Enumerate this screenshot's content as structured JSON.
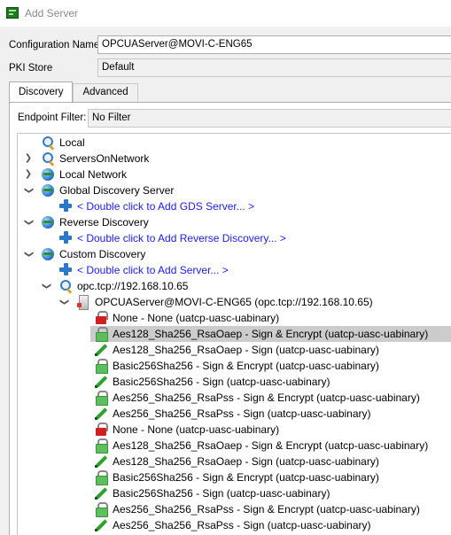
{
  "window": {
    "title": "Add Server"
  },
  "form": {
    "config_name_label": "Configuration Name",
    "config_name_value": "OPCUAServer@MOVI-C-ENG65",
    "pki_store_label": "PKI Store",
    "pki_store_value": "Default"
  },
  "tabs": [
    {
      "label": "Discovery",
      "active": true
    },
    {
      "label": "Advanced",
      "active": false
    }
  ],
  "filter": {
    "label": "Endpoint Filter:",
    "value": "No Filter"
  },
  "tree": {
    "local": "Local",
    "servers_on_network": "ServersOnNetwork",
    "local_network": "Local Network",
    "gds": "Global Discovery Server",
    "gds_add": "< Double click to Add GDS Server... >",
    "reverse": "Reverse Discovery",
    "reverse_add": "< Double click to Add Reverse Discovery... >",
    "custom": "Custom Discovery",
    "custom_add": "< Double click to Add Server... >",
    "host": "opc.tcp://192.168.10.65",
    "server": "OPCUAServer@MOVI-C-ENG65 (opc.tcp://192.168.10.65)",
    "endpoints": [
      {
        "label": "None - None (uatcp-uasc-uabinary)",
        "icon": "lock-red"
      },
      {
        "label": "Aes128_Sha256_RsaOaep - Sign & Encrypt (uatcp-uasc-uabinary)",
        "icon": "lock-green",
        "selected": true
      },
      {
        "label": "Aes128_Sha256_RsaOaep - Sign (uatcp-uasc-uabinary)",
        "icon": "pen"
      },
      {
        "label": "Basic256Sha256 - Sign & Encrypt (uatcp-uasc-uabinary)",
        "icon": "lock-green"
      },
      {
        "label": "Basic256Sha256 - Sign (uatcp-uasc-uabinary)",
        "icon": "pen"
      },
      {
        "label": "Aes256_Sha256_RsaPss - Sign & Encrypt (uatcp-uasc-uabinary)",
        "icon": "lock-green"
      },
      {
        "label": "Aes256_Sha256_RsaPss - Sign (uatcp-uasc-uabinary)",
        "icon": "pen"
      },
      {
        "label": "None - None (uatcp-uasc-uabinary)",
        "icon": "lock-red"
      },
      {
        "label": "Aes128_Sha256_RsaOaep - Sign & Encrypt (uatcp-uasc-uabinary)",
        "icon": "lock-green"
      },
      {
        "label": "Aes128_Sha256_RsaOaep - Sign (uatcp-uasc-uabinary)",
        "icon": "pen"
      },
      {
        "label": "Basic256Sha256 - Sign & Encrypt (uatcp-uasc-uabinary)",
        "icon": "lock-green"
      },
      {
        "label": "Basic256Sha256 - Sign (uatcp-uasc-uabinary)",
        "icon": "pen"
      },
      {
        "label": "Aes256_Sha256_RsaPss - Sign & Encrypt (uatcp-uasc-uabinary)",
        "icon": "lock-green"
      },
      {
        "label": "Aes256_Sha256_RsaPss - Sign (uatcp-uasc-uabinary)",
        "icon": "pen"
      }
    ]
  },
  "colors": {
    "link": "#1a1aff",
    "selection": "#cccccc"
  }
}
